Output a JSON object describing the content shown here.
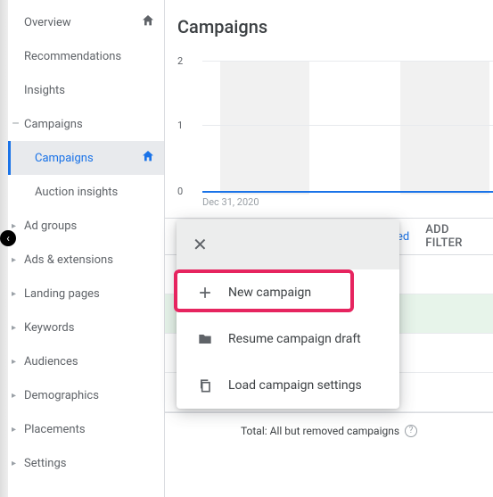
{
  "page": {
    "title": "Campaigns",
    "totals_label": "Total: All but removed campaigns",
    "add_filter_label": "ADD FILTER",
    "filter_peek": "ed"
  },
  "sidebar": {
    "items": [
      {
        "label": "Overview",
        "icon": "home",
        "caret": ""
      },
      {
        "label": "Recommendations",
        "caret": ""
      },
      {
        "label": "Insights",
        "caret": ""
      },
      {
        "label": "Campaigns",
        "caret": "minus",
        "expanded": true
      },
      {
        "label": "Campaigns",
        "sub": true,
        "active": true,
        "icon": "home"
      },
      {
        "label": "Auction insights",
        "sub": true
      },
      {
        "label": "Ad groups",
        "caret": "right"
      },
      {
        "label": "Ads & extensions",
        "caret": "right"
      },
      {
        "label": "Landing pages",
        "caret": "right"
      },
      {
        "label": "Keywords",
        "caret": "right"
      },
      {
        "label": "Audiences",
        "caret": "right"
      },
      {
        "label": "Demographics",
        "caret": "right"
      },
      {
        "label": "Placements",
        "caret": "right"
      },
      {
        "label": "Settings",
        "caret": "right"
      }
    ]
  },
  "chart_data": {
    "type": "line",
    "title": "",
    "xlabel": "",
    "ylabel": "",
    "ylim": [
      0,
      2
    ],
    "yticks": [
      0,
      1,
      2
    ],
    "x_start_label": "Dec 31, 2020",
    "series": [
      {
        "name": "",
        "values": [
          0
        ]
      }
    ]
  },
  "popover": {
    "items": [
      {
        "icon": "plus",
        "label": "New campaign"
      },
      {
        "icon": "folder",
        "label": "Resume campaign draft"
      },
      {
        "icon": "copy",
        "label": "Load campaign settings"
      }
    ]
  }
}
